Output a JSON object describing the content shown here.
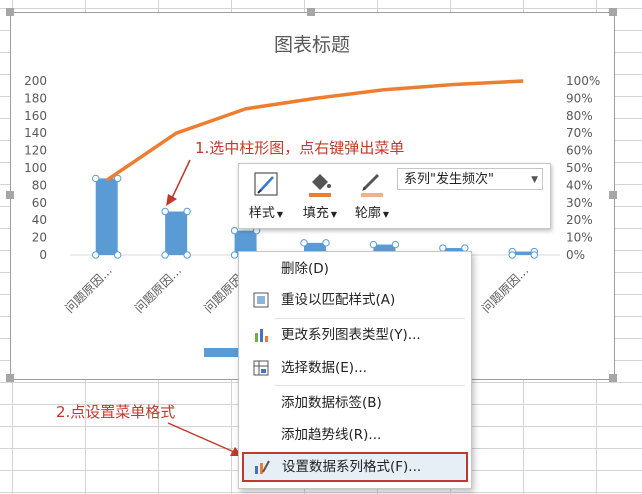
{
  "chart_data": {
    "type": "bar",
    "title": "图表标题",
    "categories": [
      "问题原因…",
      "问题原因…",
      "问题原因…",
      "问题原因…",
      "问题原因…",
      "问题原因…",
      "问题原因…"
    ],
    "series": [
      {
        "values": [
          88,
          50,
          28,
          14,
          12,
          8,
          4
        ]
      },
      {
        "values": [
          0.43,
          0.7,
          0.84,
          0.9,
          0.95,
          0.98,
          1.0
        ]
      }
    ],
    "y_left_ticks": [
      "0",
      "20",
      "40",
      "60",
      "80",
      "100",
      "120",
      "140",
      "160",
      "180",
      "200"
    ],
    "y_right_ticks": [
      "0%",
      "10%",
      "20%",
      "30%",
      "40%",
      "50%",
      "60%",
      "70%",
      "80%",
      "90%",
      "100%"
    ],
    "ylim": [
      0,
      200
    ],
    "y2lim": [
      0,
      1
    ],
    "colors": {
      "bar": "#5b9bd5",
      "line": "#ed7d31"
    }
  },
  "mini_toolbar": {
    "style_label": "样式",
    "fill_label": "填充",
    "outline_label": "轮廓",
    "series_select": "系列\"发生频次\""
  },
  "context_menu": {
    "items": [
      {
        "label": "删除(D)",
        "icon": "none"
      },
      {
        "label": "重设以匹配样式(A)",
        "icon": "reset-style-icon"
      },
      {
        "label": "更改系列图表类型(Y)...",
        "icon": "chart-type-icon"
      },
      {
        "label": "选择数据(E)...",
        "icon": "select-data-icon"
      },
      {
        "label": "添加数据标签(B)",
        "icon": "none"
      },
      {
        "label": "添加趋势线(R)...",
        "icon": "none"
      },
      {
        "label": "设置数据系列格式(F)...",
        "icon": "format-series-icon"
      }
    ]
  },
  "annotations": {
    "step1": "1.选中柱形图，点右键弹出菜单",
    "step2": "2.点设置菜单格式"
  }
}
